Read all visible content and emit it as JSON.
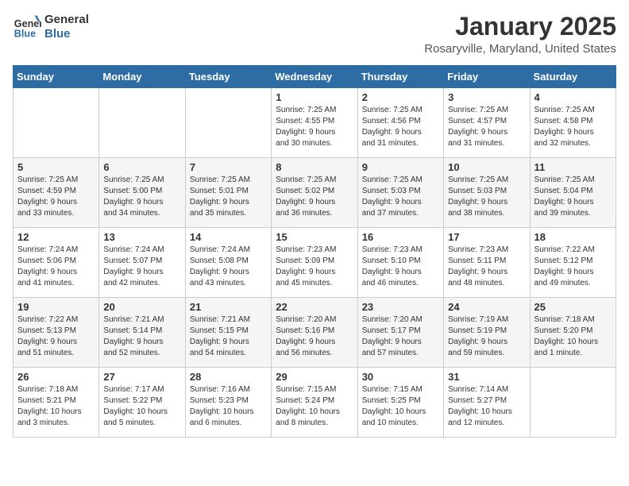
{
  "header": {
    "logo_general": "General",
    "logo_blue": "Blue",
    "title": "January 2025",
    "subtitle": "Rosaryville, Maryland, United States"
  },
  "days_of_week": [
    "Sunday",
    "Monday",
    "Tuesday",
    "Wednesday",
    "Thursday",
    "Friday",
    "Saturday"
  ],
  "weeks": [
    [
      {
        "day": "",
        "info": ""
      },
      {
        "day": "",
        "info": ""
      },
      {
        "day": "",
        "info": ""
      },
      {
        "day": "1",
        "info": "Sunrise: 7:25 AM\nSunset: 4:55 PM\nDaylight: 9 hours\nand 30 minutes."
      },
      {
        "day": "2",
        "info": "Sunrise: 7:25 AM\nSunset: 4:56 PM\nDaylight: 9 hours\nand 31 minutes."
      },
      {
        "day": "3",
        "info": "Sunrise: 7:25 AM\nSunset: 4:57 PM\nDaylight: 9 hours\nand 31 minutes."
      },
      {
        "day": "4",
        "info": "Sunrise: 7:25 AM\nSunset: 4:58 PM\nDaylight: 9 hours\nand 32 minutes."
      }
    ],
    [
      {
        "day": "5",
        "info": "Sunrise: 7:25 AM\nSunset: 4:59 PM\nDaylight: 9 hours\nand 33 minutes."
      },
      {
        "day": "6",
        "info": "Sunrise: 7:25 AM\nSunset: 5:00 PM\nDaylight: 9 hours\nand 34 minutes."
      },
      {
        "day": "7",
        "info": "Sunrise: 7:25 AM\nSunset: 5:01 PM\nDaylight: 9 hours\nand 35 minutes."
      },
      {
        "day": "8",
        "info": "Sunrise: 7:25 AM\nSunset: 5:02 PM\nDaylight: 9 hours\nand 36 minutes."
      },
      {
        "day": "9",
        "info": "Sunrise: 7:25 AM\nSunset: 5:03 PM\nDaylight: 9 hours\nand 37 minutes."
      },
      {
        "day": "10",
        "info": "Sunrise: 7:25 AM\nSunset: 5:03 PM\nDaylight: 9 hours\nand 38 minutes."
      },
      {
        "day": "11",
        "info": "Sunrise: 7:25 AM\nSunset: 5:04 PM\nDaylight: 9 hours\nand 39 minutes."
      }
    ],
    [
      {
        "day": "12",
        "info": "Sunrise: 7:24 AM\nSunset: 5:06 PM\nDaylight: 9 hours\nand 41 minutes."
      },
      {
        "day": "13",
        "info": "Sunrise: 7:24 AM\nSunset: 5:07 PM\nDaylight: 9 hours\nand 42 minutes."
      },
      {
        "day": "14",
        "info": "Sunrise: 7:24 AM\nSunset: 5:08 PM\nDaylight: 9 hours\nand 43 minutes."
      },
      {
        "day": "15",
        "info": "Sunrise: 7:23 AM\nSunset: 5:09 PM\nDaylight: 9 hours\nand 45 minutes."
      },
      {
        "day": "16",
        "info": "Sunrise: 7:23 AM\nSunset: 5:10 PM\nDaylight: 9 hours\nand 46 minutes."
      },
      {
        "day": "17",
        "info": "Sunrise: 7:23 AM\nSunset: 5:11 PM\nDaylight: 9 hours\nand 48 minutes."
      },
      {
        "day": "18",
        "info": "Sunrise: 7:22 AM\nSunset: 5:12 PM\nDaylight: 9 hours\nand 49 minutes."
      }
    ],
    [
      {
        "day": "19",
        "info": "Sunrise: 7:22 AM\nSunset: 5:13 PM\nDaylight: 9 hours\nand 51 minutes."
      },
      {
        "day": "20",
        "info": "Sunrise: 7:21 AM\nSunset: 5:14 PM\nDaylight: 9 hours\nand 52 minutes."
      },
      {
        "day": "21",
        "info": "Sunrise: 7:21 AM\nSunset: 5:15 PM\nDaylight: 9 hours\nand 54 minutes."
      },
      {
        "day": "22",
        "info": "Sunrise: 7:20 AM\nSunset: 5:16 PM\nDaylight: 9 hours\nand 56 minutes."
      },
      {
        "day": "23",
        "info": "Sunrise: 7:20 AM\nSunset: 5:17 PM\nDaylight: 9 hours\nand 57 minutes."
      },
      {
        "day": "24",
        "info": "Sunrise: 7:19 AM\nSunset: 5:19 PM\nDaylight: 9 hours\nand 59 minutes."
      },
      {
        "day": "25",
        "info": "Sunrise: 7:18 AM\nSunset: 5:20 PM\nDaylight: 10 hours\nand 1 minute."
      }
    ],
    [
      {
        "day": "26",
        "info": "Sunrise: 7:18 AM\nSunset: 5:21 PM\nDaylight: 10 hours\nand 3 minutes."
      },
      {
        "day": "27",
        "info": "Sunrise: 7:17 AM\nSunset: 5:22 PM\nDaylight: 10 hours\nand 5 minutes."
      },
      {
        "day": "28",
        "info": "Sunrise: 7:16 AM\nSunset: 5:23 PM\nDaylight: 10 hours\nand 6 minutes."
      },
      {
        "day": "29",
        "info": "Sunrise: 7:15 AM\nSunset: 5:24 PM\nDaylight: 10 hours\nand 8 minutes."
      },
      {
        "day": "30",
        "info": "Sunrise: 7:15 AM\nSunset: 5:25 PM\nDaylight: 10 hours\nand 10 minutes."
      },
      {
        "day": "31",
        "info": "Sunrise: 7:14 AM\nSunset: 5:27 PM\nDaylight: 10 hours\nand 12 minutes."
      },
      {
        "day": "",
        "info": ""
      }
    ]
  ]
}
